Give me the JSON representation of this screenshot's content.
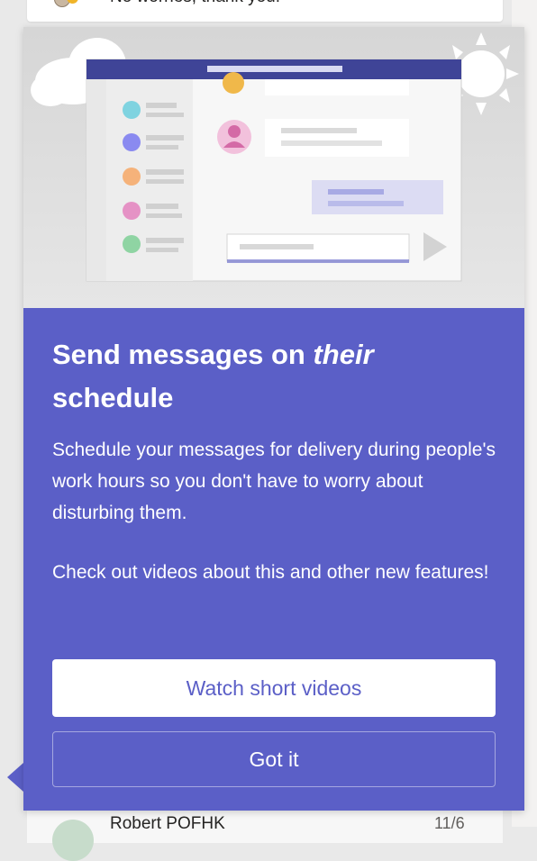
{
  "background": {
    "top_message_text": "No worries, thank you!",
    "bottom_message_name": "Robert POFHK",
    "bottom_message_time": "11/6"
  },
  "popup": {
    "title_part1": "Send messages on ",
    "title_emphasis": "their",
    "title_part2": "schedule",
    "description": "Schedule your messages for delivery during people's work hours so you don't have to worry about disturbing them.",
    "secondary_text": "Check out videos about this and other new features!",
    "primary_button_label": "Watch short videos",
    "secondary_button_label": "Got it"
  },
  "colors": {
    "accent": "#5b5fc7",
    "illustration_header": "#3f4497",
    "avatar_colors": [
      "#7fd3e0",
      "#8a8af0",
      "#f5b27a",
      "#e592c5",
      "#8fd4a3"
    ]
  },
  "icons": {
    "cloud": "cloud-icon",
    "sun": "sun-icon",
    "send": "send-icon",
    "person": "person-icon"
  }
}
